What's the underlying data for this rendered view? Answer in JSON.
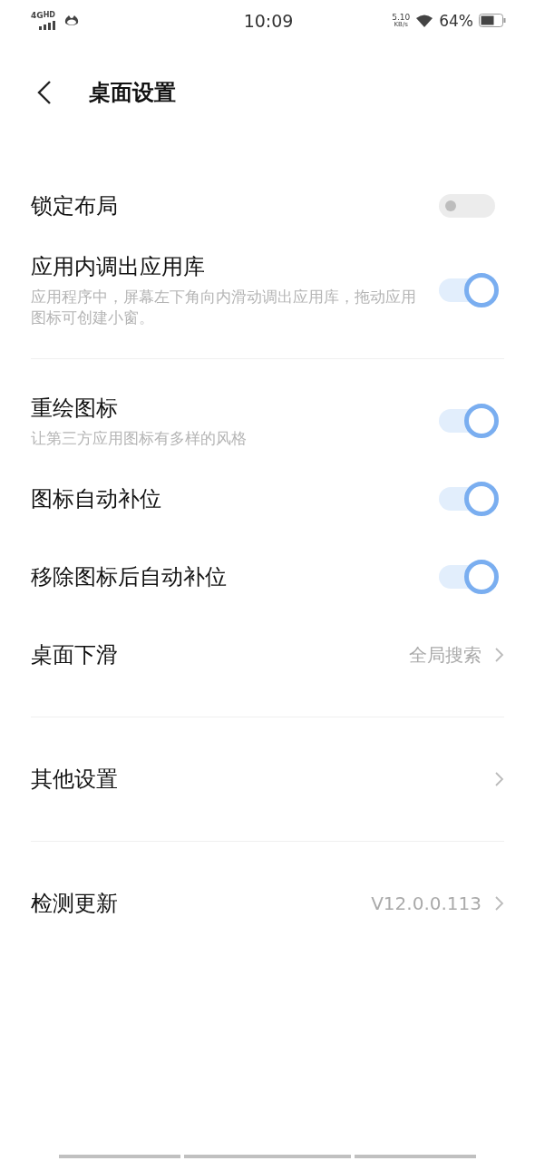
{
  "status_bar": {
    "network": "4G",
    "network_badge": "HD",
    "time": "10:09",
    "net_speed": "5.10",
    "net_speed_unit": "KB/s",
    "battery": "64%"
  },
  "header": {
    "title": "桌面设置"
  },
  "groups": [
    {
      "items": [
        {
          "kind": "toggle",
          "title": "锁定布局",
          "on": false
        },
        {
          "kind": "toggle",
          "title": "应用内调出应用库",
          "description": "应用程序中，屏幕左下角向内滑动调出应用库，拖动应用图标可创建小窗。",
          "on": true
        }
      ]
    },
    {
      "items": [
        {
          "kind": "toggle",
          "title": "重绘图标",
          "description": "让第三方应用图标有多样的风格",
          "on": true
        },
        {
          "kind": "toggle",
          "title": "图标自动补位",
          "on": true
        },
        {
          "kind": "toggle",
          "title": "移除图标后自动补位",
          "on": true
        },
        {
          "kind": "link",
          "title": "桌面下滑",
          "value": "全局搜索"
        }
      ]
    },
    {
      "items": [
        {
          "kind": "link",
          "title": "其他设置"
        }
      ]
    },
    {
      "items": [
        {
          "kind": "link",
          "title": "检测更新",
          "value": "V12.0.0.113"
        }
      ]
    }
  ]
}
